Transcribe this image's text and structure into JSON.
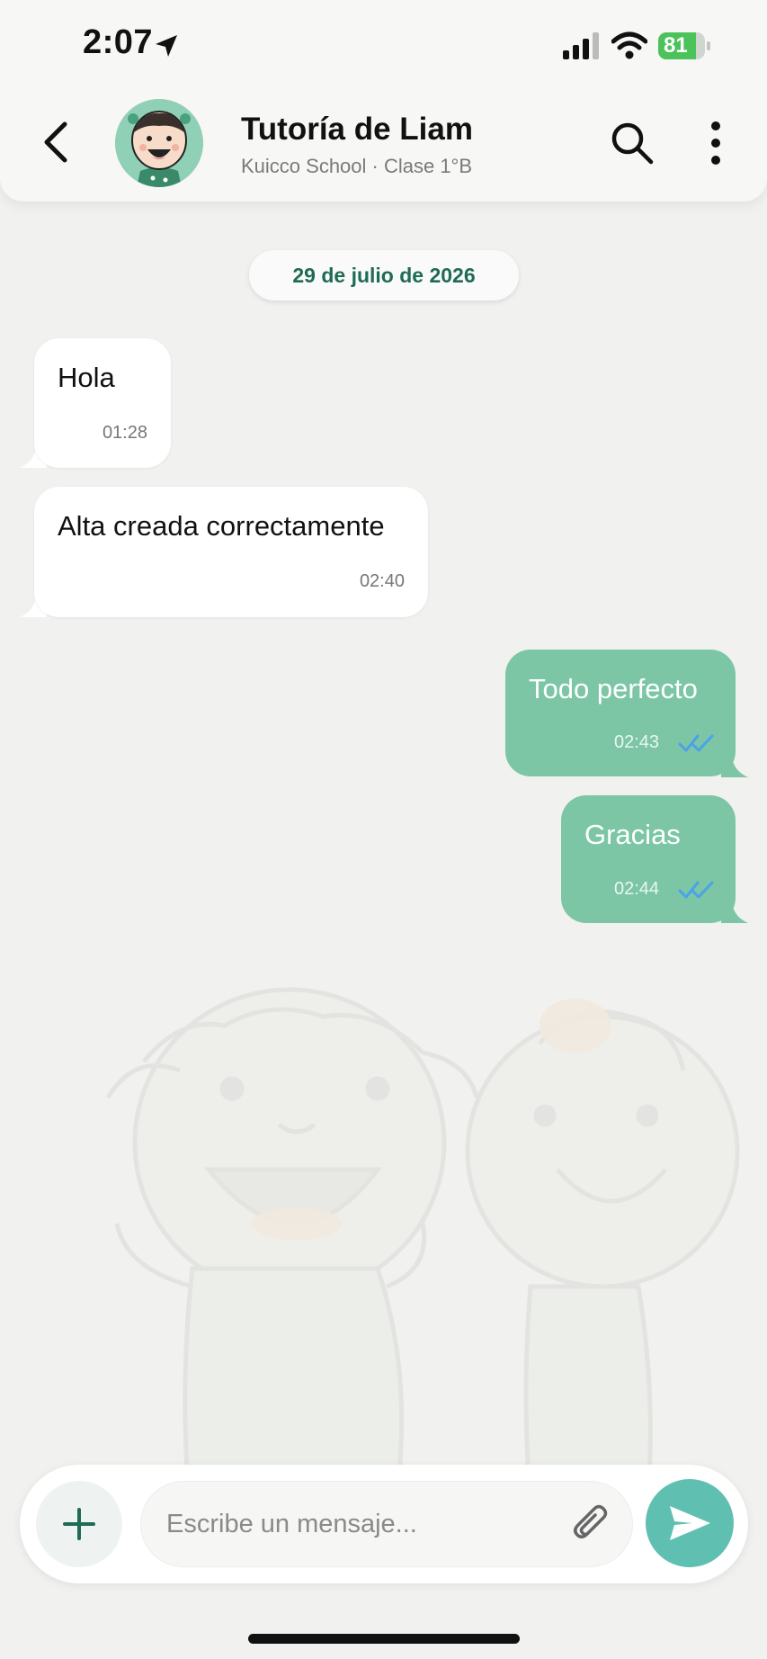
{
  "status_bar": {
    "time": "2:07",
    "battery_level": 81,
    "battery_text": "81"
  },
  "app_bar": {
    "title": "Tutoría de Liam",
    "subtitle": "Kuicco School · Clase 1°B"
  },
  "date_divider": "29 de julio de 2026",
  "messages": [
    {
      "direction": "incoming",
      "text": "Hola",
      "time": "01:28"
    },
    {
      "direction": "incoming",
      "text": "Alta creada correctamente",
      "time": "02:40"
    },
    {
      "direction": "outgoing",
      "text": "Todo perfecto",
      "time": "02:43",
      "status": "read"
    },
    {
      "direction": "outgoing",
      "text": "Gracias",
      "time": "02:44",
      "status": "read"
    }
  ],
  "composer": {
    "placeholder": "Escribe un mensaje..."
  },
  "colors": {
    "accent": "#1f6b55",
    "outgoing_bubble": "#7cc6a6",
    "send_button": "#5fc0b1",
    "read_ticks": "#4aa3e6",
    "battery": "#4cc25a"
  }
}
